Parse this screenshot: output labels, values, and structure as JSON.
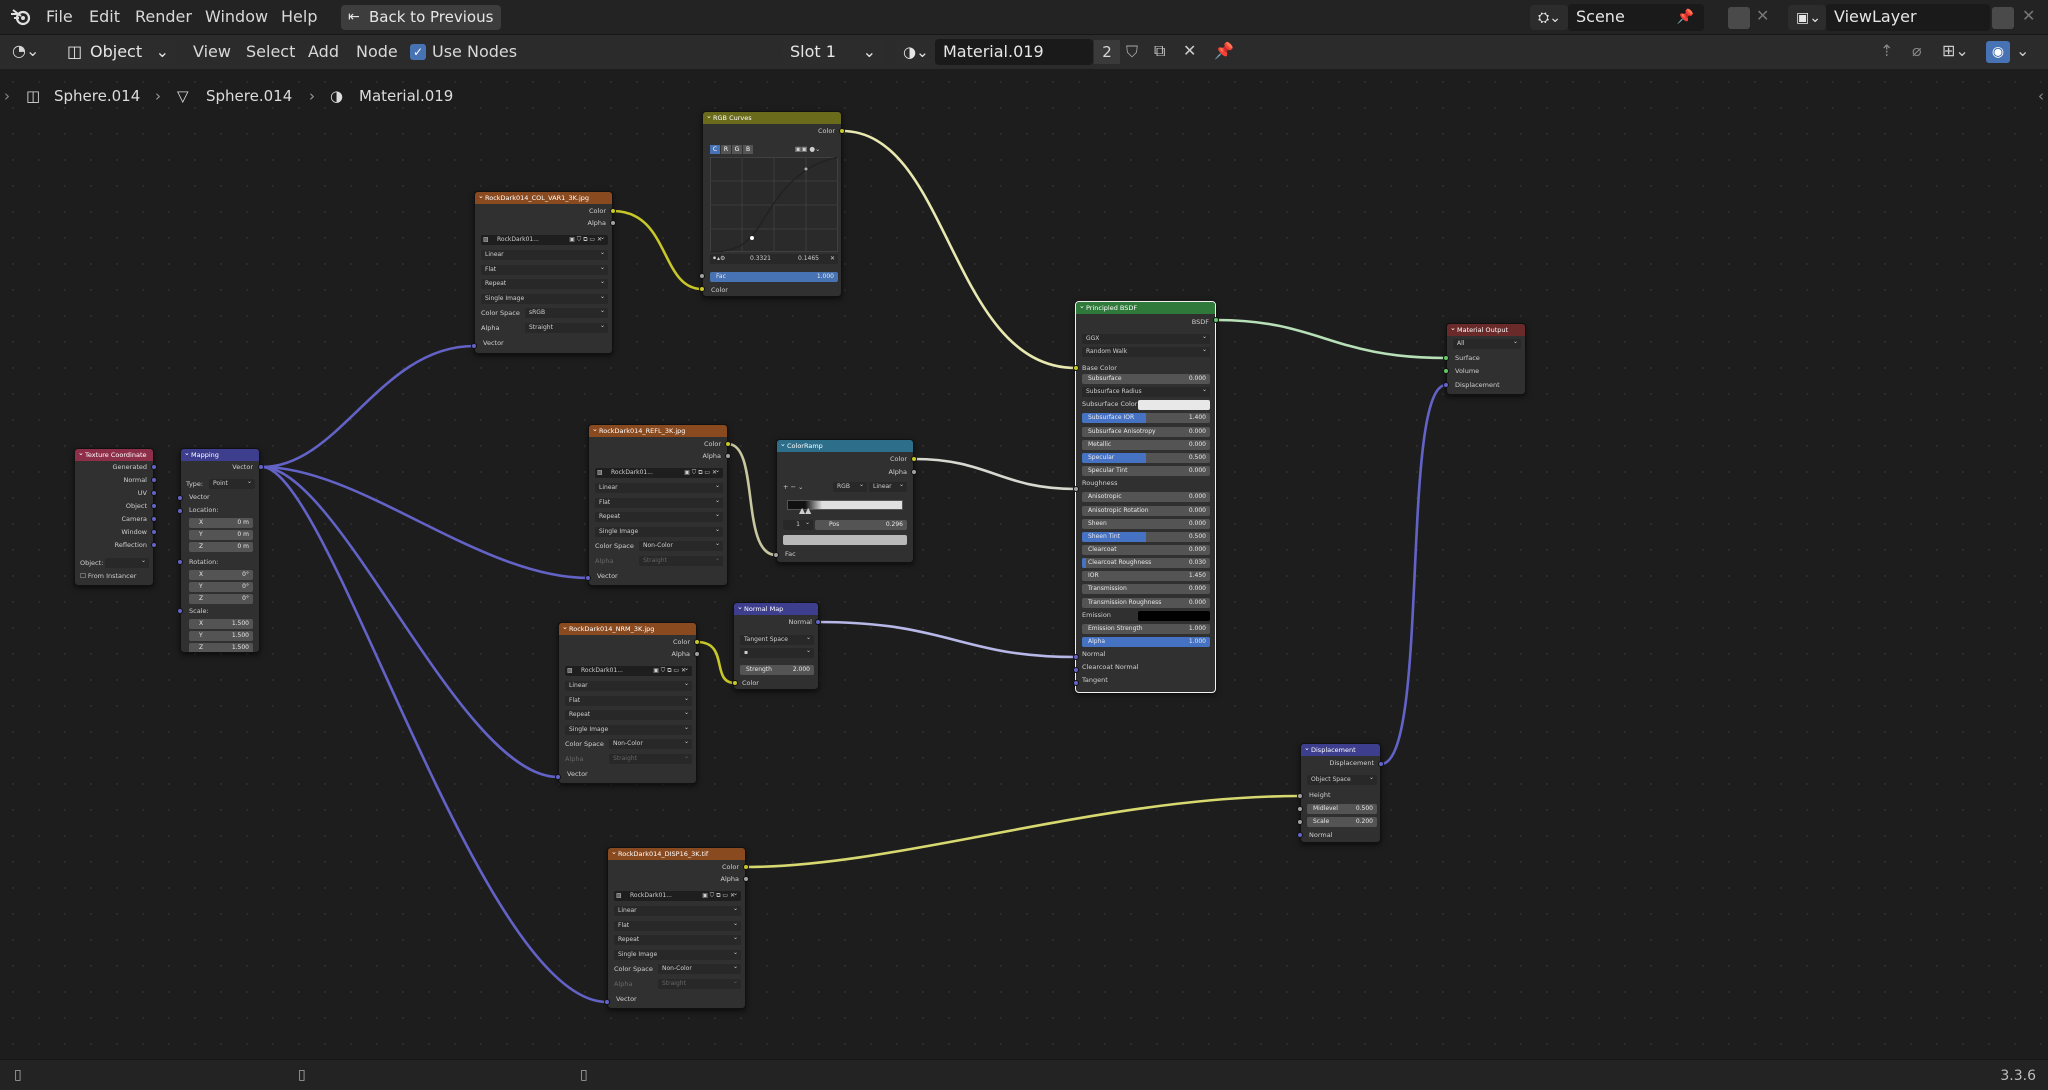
{
  "menu": {
    "file": "File",
    "edit": "Edit",
    "render": "Render",
    "window": "Window",
    "help": "Help",
    "back": "Back to Previous"
  },
  "scene": {
    "name": "Scene",
    "view_layer": "ViewLayer"
  },
  "header": {
    "mode": "Object",
    "view": "View",
    "select": "Select",
    "add": "Add",
    "node": "Node",
    "use_nodes": "Use Nodes",
    "slot": "Slot 1",
    "material": "Material.019",
    "users": "2"
  },
  "breadcrumb": {
    "object": "Sphere.014",
    "mesh": "Sphere.014",
    "material": "Material.019"
  },
  "version": "3.3.6",
  "nodes": {
    "texcoord": {
      "title": "Texture Coordinate",
      "outputs": [
        "Generated",
        "Normal",
        "UV",
        "Object",
        "Camera",
        "Window",
        "Reflection"
      ],
      "object_label": "Object:",
      "from_instancer": "From Instancer"
    },
    "mapping": {
      "title": "Mapping",
      "output": "Vector",
      "type_label": "Type:",
      "type": "Point",
      "vector": "Vector",
      "location": "Location:",
      "rotation": "Rotation:",
      "scale": "Scale:",
      "loc": [
        [
          "X",
          "0 m"
        ],
        [
          "Y",
          "0 m"
        ],
        [
          "Z",
          "0 m"
        ]
      ],
      "rot": [
        [
          "X",
          "0°"
        ],
        [
          "Y",
          "0°"
        ],
        [
          "Z",
          "0°"
        ]
      ],
      "scl": [
        [
          "X",
          "1.500"
        ],
        [
          "Y",
          "1.500"
        ],
        [
          "Z",
          "1.500"
        ]
      ]
    },
    "col": {
      "title": "RockDark014_COL_VAR1_3K.jpg",
      "img": "RockDark01...",
      "interp": "Linear",
      "proj": "Flat",
      "ext": "Repeat",
      "src": "Single Image",
      "cs_label": "Color Space",
      "cs": "sRGB",
      "alpha_label": "Alpha",
      "alpha": "Straight",
      "color": "Color",
      "alpha_out": "Alpha",
      "vector": "Vector"
    },
    "refl": {
      "title": "RockDark014_REFL_3K.jpg",
      "img": "RockDark01...",
      "interp": "Linear",
      "proj": "Flat",
      "ext": "Repeat",
      "src": "Single Image",
      "cs_label": "Color Space",
      "cs": "Non-Color",
      "alpha_label": "Alpha",
      "alpha": "Straight",
      "color": "Color",
      "alpha_out": "Alpha",
      "vector": "Vector"
    },
    "nrm": {
      "title": "RockDark014_NRM_3K.jpg",
      "img": "RockDark01...",
      "interp": "Linear",
      "proj": "Flat",
      "ext": "Repeat",
      "src": "Single Image",
      "cs_label": "Color Space",
      "cs": "Non-Color",
      "alpha_label": "Alpha",
      "alpha": "Straight",
      "color": "Color",
      "alpha_out": "Alpha",
      "vector": "Vector"
    },
    "disp": {
      "title": "RockDark014_DISP16_3K.tif",
      "img": "RockDark01...",
      "interp": "Linear",
      "proj": "Flat",
      "ext": "Repeat",
      "src": "Single Image",
      "cs_label": "Color Space",
      "cs": "Non-Color",
      "alpha_label": "Alpha",
      "alpha": "Straight",
      "color": "Color",
      "alpha_out": "Alpha",
      "vector": "Vector"
    },
    "curves": {
      "title": "RGB Curves",
      "color_out": "Color",
      "tabs": [
        "C",
        "R",
        "G",
        "B"
      ],
      "x": "0.3321",
      "y": "0.1465",
      "fac_label": "Fac",
      "fac": "1.000",
      "color_in": "Color"
    },
    "ramp": {
      "title": "ColorRamp",
      "color": "Color",
      "alpha": "Alpha",
      "mode": "RGB",
      "interp": "Linear",
      "index": "1",
      "pos_label": "Pos",
      "pos": "0.296",
      "fac": "Fac"
    },
    "normalmap": {
      "title": "Normal Map",
      "normal": "Normal",
      "space": "Tangent Space",
      "strength_label": "Strength",
      "strength": "2.000",
      "color": "Color"
    },
    "bsdf": {
      "title": "Principled BSDF",
      "out": "BSDF",
      "dist": "GGX",
      "sss_method": "Random Walk",
      "base_color": "Base Color",
      "props": [
        {
          "label": "Subsurface",
          "value": "0.000",
          "fill": 0
        },
        {
          "label": "Subsurface Radius",
          "value": "",
          "fill": 0,
          "dropdown": true
        },
        {
          "label": "Subsurface Color",
          "value": "",
          "fill": 0,
          "swatch": "#e8e8e8"
        },
        {
          "label": "Subsurface IOR",
          "value": "1.400",
          "fill": 0.5
        },
        {
          "label": "Subsurface Anisotropy",
          "value": "0.000",
          "fill": 0
        },
        {
          "label": "Metallic",
          "value": "0.000",
          "fill": 0
        },
        {
          "label": "Specular",
          "value": "0.500",
          "fill": 0.5
        },
        {
          "label": "Specular Tint",
          "value": "0.000",
          "fill": 0
        },
        {
          "label": "Roughness",
          "value": "",
          "fill": 0,
          "socket": true
        },
        {
          "label": "Anisotropic",
          "value": "0.000",
          "fill": 0
        },
        {
          "label": "Anisotropic Rotation",
          "value": "0.000",
          "fill": 0
        },
        {
          "label": "Sheen",
          "value": "0.000",
          "fill": 0
        },
        {
          "label": "Sheen Tint",
          "value": "0.500",
          "fill": 0.5
        },
        {
          "label": "Clearcoat",
          "value": "0.000",
          "fill": 0
        },
        {
          "label": "Clearcoat Roughness",
          "value": "0.030",
          "fill": 0.03
        },
        {
          "label": "IOR",
          "value": "1.450",
          "fill": 0
        },
        {
          "label": "Transmission",
          "value": "0.000",
          "fill": 0
        },
        {
          "label": "Transmission Roughness",
          "value": "0.000",
          "fill": 0
        },
        {
          "label": "Emission",
          "value": "",
          "fill": 0,
          "swatch": "#000000"
        },
        {
          "label": "Emission Strength",
          "value": "1.000",
          "fill": 0
        },
        {
          "label": "Alpha",
          "value": "1.000",
          "fill": 1
        },
        {
          "label": "Normal",
          "value": "",
          "fill": 0,
          "socket": true
        },
        {
          "label": "Clearcoat Normal",
          "value": "",
          "fill": 0,
          "socket": true
        },
        {
          "label": "Tangent",
          "value": "",
          "fill": 0,
          "socket": true
        }
      ]
    },
    "output": {
      "title": "Material Output",
      "target": "All",
      "surface": "Surface",
      "volume": "Volume",
      "displacement": "Displacement"
    },
    "displacement": {
      "title": "Displacement",
      "out": "Displacement",
      "space": "Object Space",
      "height": "Height",
      "midlevel_label": "Midlevel",
      "midlevel": "0.500",
      "scale_label": "Scale",
      "scale": "0.200",
      "normal": "Normal"
    }
  },
  "colors": {
    "image_header": "#8a4a1f",
    "vector_header": "#3e3e8e",
    "input_header": "#8e2f4a",
    "color_header": "#6b6b1c",
    "converter_header": "#2d6f8a",
    "shader_header": "#2f7a3a",
    "output_header": "#6a2a2a",
    "accent": "#4772b3"
  }
}
